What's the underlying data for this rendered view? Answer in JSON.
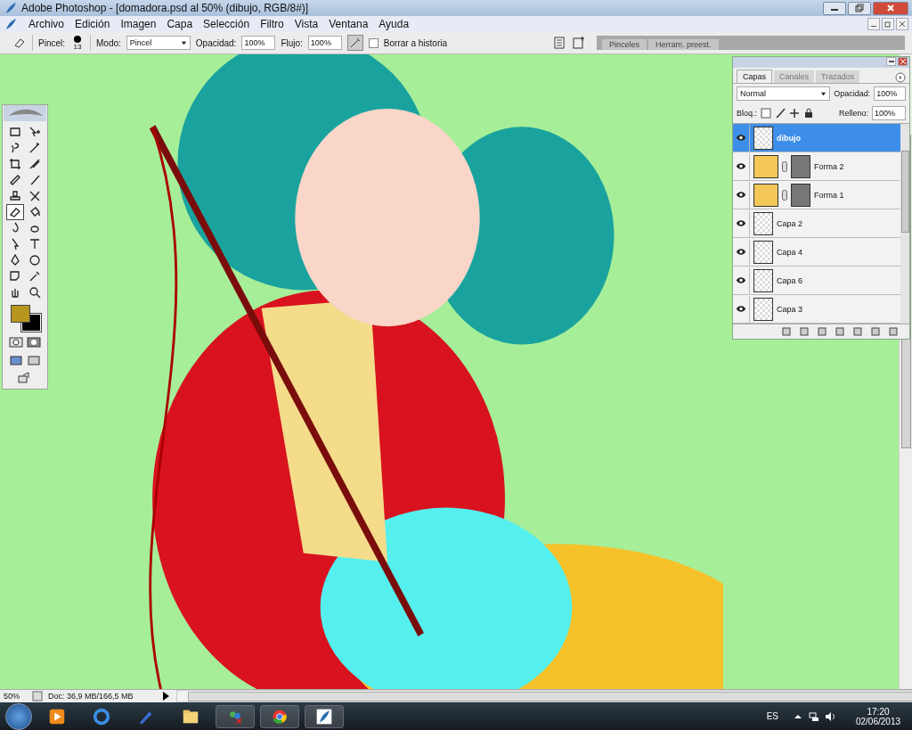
{
  "window": {
    "title": "Adobe Photoshop - [domadora.psd al 50% (dibujo, RGB/8#)]"
  },
  "menu": [
    "Archivo",
    "Edición",
    "Imagen",
    "Capa",
    "Selección",
    "Filtro",
    "Vista",
    "Ventana",
    "Ayuda"
  ],
  "options_bar": {
    "brush_label": "Pincel:",
    "brush_size": "13",
    "mode_label": "Modo:",
    "mode": "Pincel",
    "opacity_label": "Opacidad:",
    "opacity": "100%",
    "flow_label": "Flujo:",
    "flow": "100%",
    "erase_to_history": {
      "label": "Borrar a historia",
      "checked": false
    }
  },
  "palette_well": [
    "Pinceles",
    "Herram. preest."
  ],
  "tools": [
    {
      "kind": "marquee",
      "selected": false
    },
    {
      "kind": "move",
      "selected": false
    },
    {
      "kind": "lasso",
      "selected": false
    },
    {
      "kind": "wand",
      "selected": false
    },
    {
      "kind": "crop",
      "selected": false
    },
    {
      "kind": "slice",
      "selected": false
    },
    {
      "kind": "healing",
      "selected": false
    },
    {
      "kind": "brush",
      "selected": false
    },
    {
      "kind": "stamp",
      "selected": false
    },
    {
      "kind": "history",
      "selected": false
    },
    {
      "kind": "eraser",
      "selected": true
    },
    {
      "kind": "bucket",
      "selected": false
    },
    {
      "kind": "blur",
      "selected": false
    },
    {
      "kind": "dodge",
      "selected": false
    },
    {
      "kind": "select",
      "selected": false
    },
    {
      "kind": "type",
      "selected": false
    },
    {
      "kind": "pen",
      "selected": false
    },
    {
      "kind": "shape",
      "selected": false
    },
    {
      "kind": "notes",
      "selected": false
    },
    {
      "kind": "eyedropper",
      "selected": false
    },
    {
      "kind": "hand",
      "selected": false
    },
    {
      "kind": "zoom",
      "selected": false
    }
  ],
  "layers_panel": {
    "tabs": [
      {
        "label": "Capas",
        "selected": true
      },
      {
        "label": "Canales",
        "selected": false
      },
      {
        "label": "Trazados",
        "selected": false
      }
    ],
    "blend_mode": "Normal",
    "opacity_label": "Opacidad:",
    "opacity": "100%",
    "lock_label": "Bloq.:",
    "fill_label": "Relleno:",
    "fill": "100%",
    "layers": [
      {
        "name": "dibujo",
        "kind": "raster",
        "visible": true,
        "selected": true
      },
      {
        "name": "Forma 2",
        "kind": "shape",
        "visible": true,
        "selected": false
      },
      {
        "name": "Forma 1",
        "kind": "shape",
        "visible": true,
        "selected": false
      },
      {
        "name": "Capa 2",
        "kind": "raster",
        "visible": true,
        "selected": false
      },
      {
        "name": "Capa 4",
        "kind": "raster",
        "visible": true,
        "selected": false
      },
      {
        "name": "Capa 6",
        "kind": "raster",
        "visible": true,
        "selected": false
      },
      {
        "name": "Capa 3",
        "kind": "raster",
        "visible": true,
        "selected": false
      }
    ]
  },
  "status_bar": {
    "zoom": "50%",
    "doc": "Doc: 36,9 MB/166,5 MB"
  },
  "taskbar": {
    "language": "ES",
    "time": "17:20",
    "date": "02/06/2013"
  }
}
